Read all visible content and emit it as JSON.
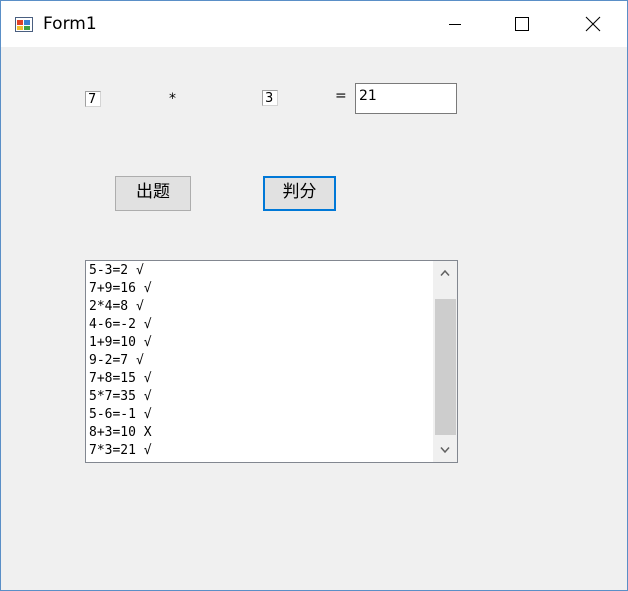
{
  "window": {
    "title": "Form1"
  },
  "form": {
    "operand1": "7",
    "operator": "*",
    "operand2": "3",
    "equals": "=",
    "answer": "21"
  },
  "buttons": {
    "new_question": "出题",
    "grade": "判分"
  },
  "results": [
    "5-3=2 √",
    "7+9=16 √",
    "2*4=8 √",
    "4-6=-2 √",
    "1+9=10 √",
    "9-2=7 √",
    "7+8=15 √",
    "5*7=35 √",
    "5-6=-1 √",
    "8+3=10 X",
    "7*3=21 √"
  ],
  "colors": {
    "focus_border": "#0078d7",
    "window_border": "#5a8fc7",
    "client_bg": "#f0f0f0"
  }
}
